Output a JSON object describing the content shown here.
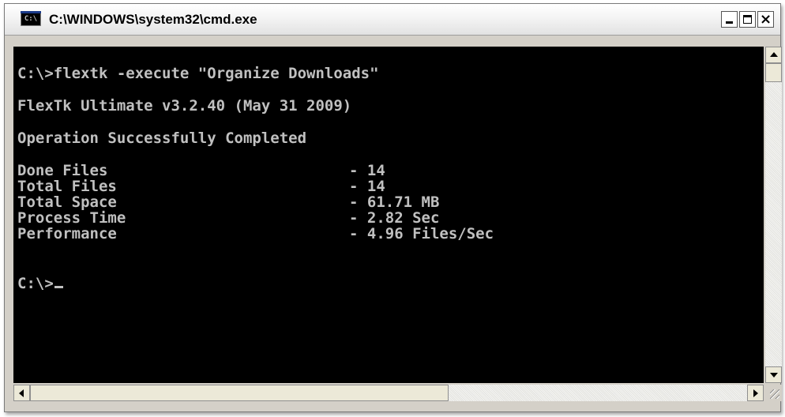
{
  "window": {
    "title": "C:\\WINDOWS\\system32\\cmd.exe",
    "icon": "console-icon",
    "icon_glyph": "C:\\",
    "buttons": {
      "minimize": "minimize-icon",
      "maximize": "maximize-icon",
      "close_label": "×"
    }
  },
  "console": {
    "command_line": "C:\\>flextk -execute \"Organize Downloads\"",
    "version_line": "FlexTk Ultimate v3.2.40 (May 31 2009)",
    "status_line": "Operation Successfully Completed",
    "stats": [
      {
        "label": "Done Files",
        "value": "- 14"
      },
      {
        "label": "Total Files",
        "value": "- 14"
      },
      {
        "label": "Total Space",
        "value": "- 61.71 MB"
      },
      {
        "label": "Process Time",
        "value": "- 2.82 Sec"
      },
      {
        "label": "Performance",
        "value": "- 4.96 Files/Sec"
      }
    ],
    "prompt": "C:\\>",
    "colors": {
      "background": "#000000",
      "text": "#c0c0c0"
    }
  },
  "scrollbars": {
    "vertical": "vertical-scrollbar",
    "horizontal": "horizontal-scrollbar"
  }
}
